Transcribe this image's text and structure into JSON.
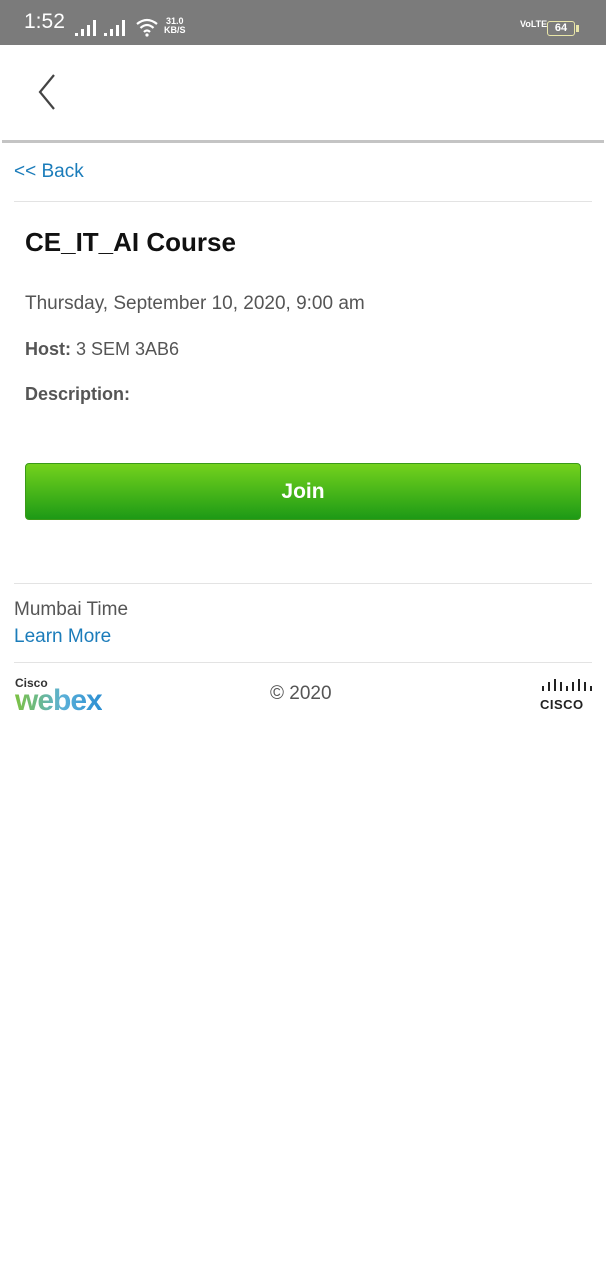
{
  "status_bar": {
    "time": "1:52",
    "speed_value": "31.0",
    "speed_unit": "KB/S",
    "network": "VoLTE",
    "battery": "64"
  },
  "icons": {
    "back": "chevron-left-icon",
    "signal": "signal-icon",
    "wifi": "wifi-icon",
    "battery": "battery-icon"
  },
  "page": {
    "back_link": "<< Back",
    "title": "CE_IT_AI Course",
    "datetime": "Thursday, September 10, 2020, 9:00 am",
    "host_label": "Host:",
    "host_value": " 3 SEM 3AB6",
    "description_label": "Description:",
    "join_label": "Join"
  },
  "footer": {
    "timezone": "Mumbai Time",
    "learn_more": "Learn More",
    "webex_cisco": "Cisco",
    "webex_word": "webex",
    "copyright": "© 2020",
    "cisco_word": "CISCO"
  },
  "colors": {
    "link": "#1b7cba",
    "join_top": "#74d21d",
    "join_bottom": "#1d9a16",
    "status_bar": "#7b7b7b"
  }
}
